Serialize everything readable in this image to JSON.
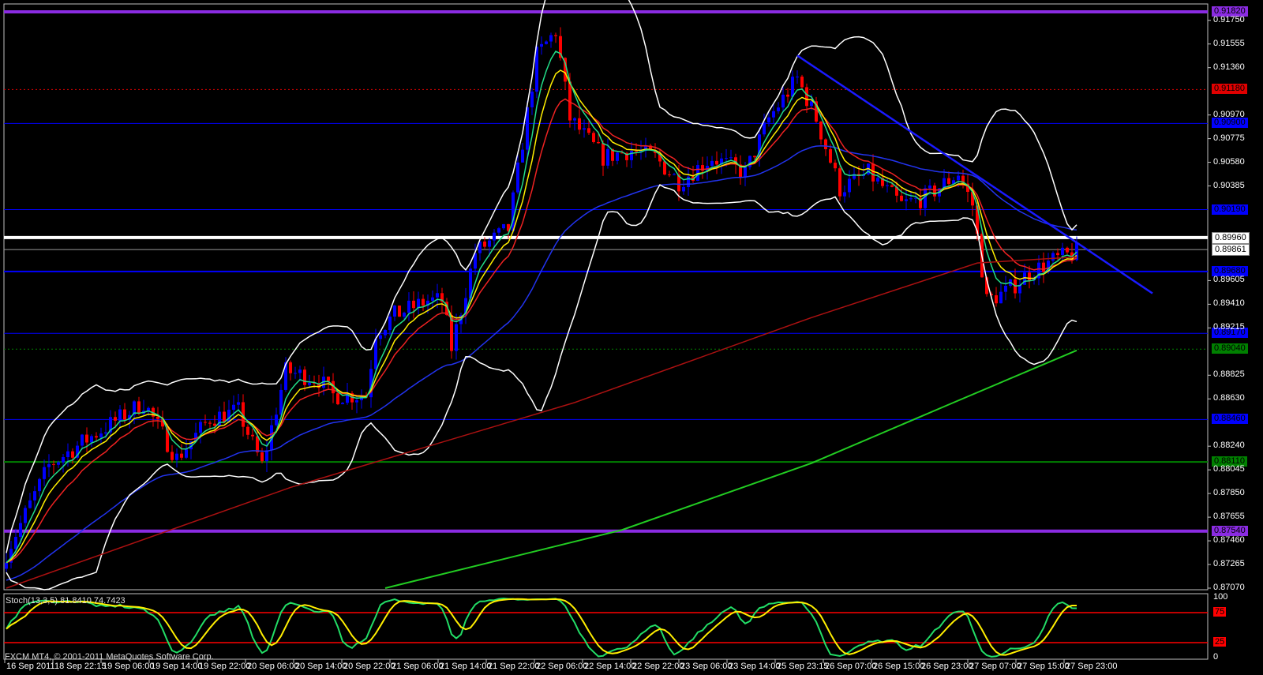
{
  "indicator_label": "Stoch(13,3,5) 81.8410 74.7423",
  "copyright": "FXCM MT4, © 2001-2011 MetaQuotes Software Corp.",
  "chart_data": {
    "type": "candlestick",
    "price_range": [
      0.8707,
      0.9182
    ],
    "price_ticks": [
      "0.91750",
      "0.91555",
      "0.91360",
      "0.90970",
      "0.90775",
      "0.90580",
      "0.90385",
      "0.89605",
      "0.89410",
      "0.89215",
      "0.88825",
      "0.88630",
      "0.88240",
      "0.88045",
      "0.87850",
      "0.87655",
      "0.87460",
      "0.87265",
      "0.87070"
    ],
    "time_labels": [
      "16 Sep 2011",
      "18 Sep 22:15",
      "19 Sep 06:00",
      "19 Sep 14:00",
      "19 Sep 22:00",
      "20 Sep 06:00",
      "20 Sep 14:00",
      "20 Sep 22:00",
      "21 Sep 06:00",
      "21 Sep 14:00",
      "21 Sep 22:00",
      "22 Sep 06:00",
      "22 Sep 14:00",
      "22 Sep 22:00",
      "23 Sep 06:00",
      "23 Sep 14:00",
      "25 Sep 23:15",
      "26 Sep 07:00",
      "26 Sep 15:00",
      "26 Sep 23:00",
      "27 Sep 07:00",
      "27 Sep 15:00",
      "27 Sep 23:00"
    ],
    "bar_count": 256,
    "approx_close_path": [
      [
        0,
        0.8736
      ],
      [
        9,
        0.8808
      ],
      [
        16,
        0.8827
      ],
      [
        29,
        0.886
      ],
      [
        36,
        0.8814
      ],
      [
        43,
        0.8847
      ],
      [
        49,
        0.8853
      ],
      [
        54,
        0.8808
      ],
      [
        59,
        0.8886
      ],
      [
        66,
        0.8879
      ],
      [
        69,
        0.8866
      ],
      [
        76,
        0.8866
      ],
      [
        78,
        0.8918
      ],
      [
        82,
        0.8932
      ],
      [
        89,
        0.8944
      ],
      [
        92,
        0.8944
      ],
      [
        94,
        0.8905
      ],
      [
        99,
        0.8984
      ],
      [
        106,
        0.9003
      ],
      [
        112,
        0.9146
      ],
      [
        116,
        0.9166
      ],
      [
        119,
        0.9094
      ],
      [
        126,
        0.9062
      ],
      [
        132,
        0.9068
      ],
      [
        137,
        0.9062
      ],
      [
        142,
        0.9042
      ],
      [
        149,
        0.9062
      ],
      [
        156,
        0.9049
      ],
      [
        161,
        0.9094
      ],
      [
        167,
        0.9127
      ],
      [
        171,
        0.9094
      ],
      [
        176,
        0.9036
      ],
      [
        182,
        0.9049
      ],
      [
        189,
        0.9023
      ],
      [
        194,
        0.9029
      ],
      [
        201,
        0.9049
      ],
      [
        204,
        0.9023
      ],
      [
        207,
        0.8944
      ],
      [
        211,
        0.8951
      ],
      [
        216,
        0.8967
      ],
      [
        221,
        0.8977
      ],
      [
        226,
        0.8984
      ]
    ],
    "long_ma_darkred": [
      [
        0,
        0.8707
      ],
      [
        60,
        0.879
      ],
      [
        120,
        0.886
      ],
      [
        170,
        0.893
      ],
      [
        205,
        0.8975
      ],
      [
        226,
        0.898
      ]
    ],
    "long_ma_green": [
      [
        80,
        0.8707
      ],
      [
        130,
        0.8755
      ],
      [
        170,
        0.881
      ],
      [
        200,
        0.886
      ],
      [
        226,
        0.8903
      ]
    ],
    "horizontal_levels": [
      {
        "price": "0.91820",
        "color": "#8a2be2",
        "style": "thick"
      },
      {
        "price": "0.91180",
        "color": "#e00000",
        "style": "dotted"
      },
      {
        "price": "0.90900",
        "color": "#0000ff",
        "style": "thin"
      },
      {
        "price": "0.90190",
        "color": "#0000ff",
        "style": "thin"
      },
      {
        "price": "0.89960",
        "color": "#ffffff",
        "style": "thick"
      },
      {
        "price": "0.89861",
        "color": "#999999",
        "style": "thin"
      },
      {
        "price": "0.89680",
        "color": "#0000ff",
        "style": "medium"
      },
      {
        "price": "0.89170",
        "color": "#0000ff",
        "style": "thin"
      },
      {
        "price": "0.89040",
        "color": "#008000",
        "style": "dotted"
      },
      {
        "price": "0.88460",
        "color": "#0000ff",
        "style": "thin"
      },
      {
        "price": "0.88110",
        "color": "#008000",
        "style": "medium"
      },
      {
        "price": "0.87540",
        "color": "#8a2be2",
        "style": "thick"
      }
    ],
    "trendline": [
      [
        0.9146,
        167
      ],
      [
        0.895,
        242
      ]
    ],
    "stoch": {
      "params": "13,3,5",
      "main": 81.841,
      "signal": 74.7423,
      "levels": [
        "100",
        "75",
        "25",
        "0"
      ]
    }
  }
}
